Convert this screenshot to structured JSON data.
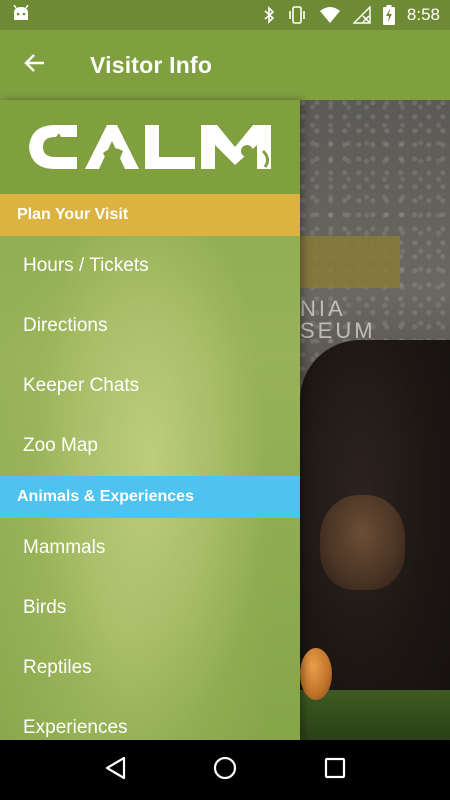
{
  "status_bar": {
    "time": "8:58",
    "icons": [
      "android-icon",
      "bluetooth-icon",
      "vibrate-icon",
      "wifi-icon",
      "no-signal-icon",
      "battery-charging-icon"
    ]
  },
  "app_bar": {
    "title": "Visitor Info",
    "back_icon": "arrow-left-icon"
  },
  "drawer": {
    "logo_text": "CALM",
    "sections": [
      {
        "header": "Plan Your Visit",
        "color": "#dcb240",
        "items": [
          "Hours / Tickets",
          "Directions",
          "Keeper Chats",
          "Zoo Map"
        ]
      },
      {
        "header": "Animals & Experiences",
        "color": "#4fc3f0",
        "items": [
          "Mammals",
          "Birds",
          "Reptiles",
          "Experiences"
        ]
      }
    ]
  },
  "background": {
    "sign_line1": "NIA",
    "sign_line2": "SEUM"
  },
  "nav_bar": {
    "buttons": [
      "back-triangle-icon",
      "home-circle-icon",
      "recents-square-icon"
    ]
  },
  "colors": {
    "status_bar": "#6f8a35",
    "app_bar": "#80a040",
    "plan_header": "#dcb240",
    "animals_header": "#4fc3f0"
  }
}
